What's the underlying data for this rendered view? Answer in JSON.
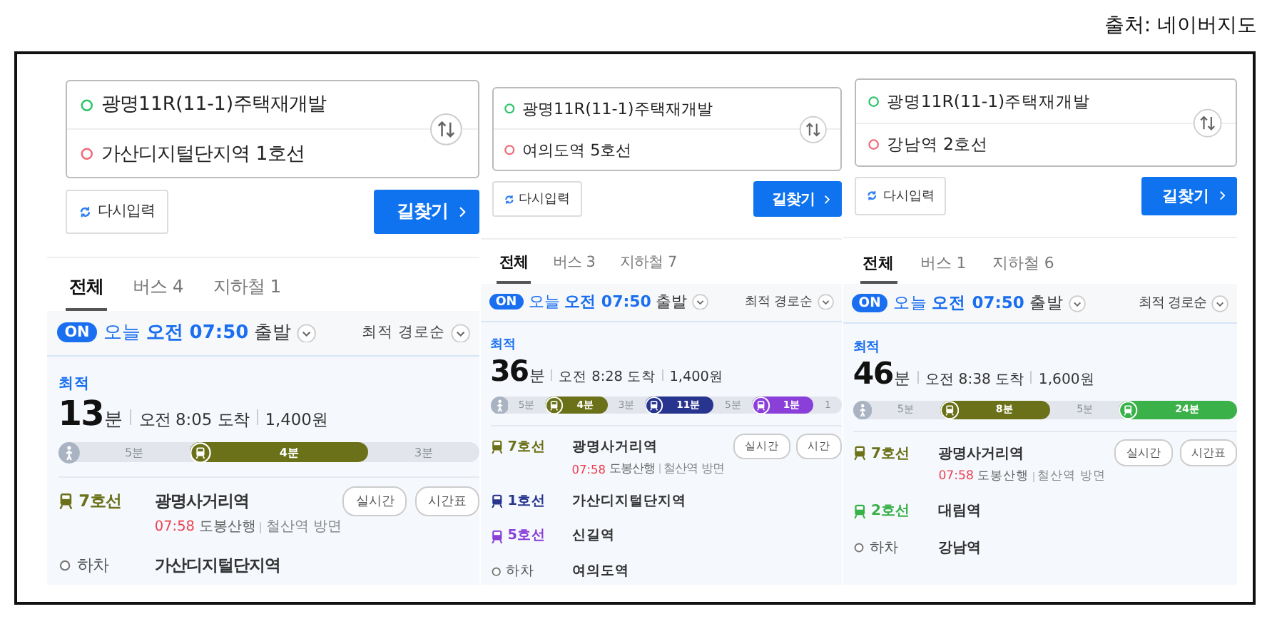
{
  "source": "출처: 네이버지도",
  "panels": [
    {
      "origin": "광명11R(11-1)주택재개발",
      "destination": "가산디지털단지역 1호선",
      "reset_label": "다시입력",
      "search_label": "길찾기",
      "tabs": [
        {
          "label": "전체",
          "selected": true
        },
        {
          "label": "버스 4",
          "selected": false
        },
        {
          "label": "지하철 1",
          "selected": false
        }
      ],
      "on_badge": "ON",
      "day": "오늘",
      "time": "오전 07:50",
      "departure": "출발",
      "sort_label": "최적 경로순",
      "route": {
        "tag": "최적",
        "duration": "13",
        "unit": "분",
        "arrival": "오전 8:05 도착",
        "fare": "1,400원",
        "segments": [
          {
            "kind": "walk",
            "label": "5분"
          },
          {
            "kind": "subway",
            "label": "4분",
            "color": "#6b7118"
          },
          {
            "kind": "walk",
            "label": "3분"
          }
        ],
        "steps": [
          {
            "kind": "board",
            "line": "7호선",
            "color": "#6b7118",
            "station": "광명사거리역",
            "time": "07:58",
            "direction": "도봉산행",
            "exit": "철산역 방면",
            "buttons": [
              "실시간",
              "시간표"
            ]
          },
          {
            "kind": "alight",
            "line": "하차",
            "station": "가산디지털단지역"
          }
        ]
      }
    },
    {
      "origin": "광명11R(11-1)주택재개발",
      "destination": "여의도역 5호선",
      "reset_label": "다시입력",
      "search_label": "길찾기",
      "tabs": [
        {
          "label": "전체",
          "selected": true
        },
        {
          "label": "버스 3",
          "selected": false
        },
        {
          "label": "지하철 7",
          "selected": false
        }
      ],
      "on_badge": "ON",
      "day": "오늘",
      "time": "오전 07:50",
      "departure": "출발",
      "sort_label": "최적 경로순",
      "route": {
        "tag": "최적",
        "duration": "36",
        "unit": "분",
        "arrival": "오전 8:28 도착",
        "fare": "1,400원",
        "segments": [
          {
            "kind": "walk",
            "label": "5분"
          },
          {
            "kind": "subway",
            "label": "4분",
            "color": "#6b7118"
          },
          {
            "kind": "walk",
            "label": "3분"
          },
          {
            "kind": "subway",
            "label": "11분",
            "color": "#27358f"
          },
          {
            "kind": "walk",
            "label": "5분"
          },
          {
            "kind": "subway",
            "label": "1분",
            "color": "#8a3fd9"
          },
          {
            "kind": "walk",
            "label": "1"
          }
        ],
        "steps": [
          {
            "kind": "board",
            "line": "7호선",
            "color": "#6b7118",
            "station": "광명사거리역",
            "time": "07:58",
            "direction": "도봉산행",
            "exit": "철산역 방면",
            "buttons": [
              "실시간",
              "시간"
            ]
          },
          {
            "kind": "ride",
            "line": "1호선",
            "color": "#27358f",
            "station": "가산디지털단지역"
          },
          {
            "kind": "ride",
            "line": "5호선",
            "color": "#8a3fd9",
            "station": "신길역"
          },
          {
            "kind": "alight",
            "line": "하차",
            "station": "여의도역"
          }
        ]
      }
    },
    {
      "origin": "광명11R(11-1)주택재개발",
      "destination": "강남역 2호선",
      "reset_label": "다시입력",
      "search_label": "길찾기",
      "tabs": [
        {
          "label": "전체",
          "selected": true
        },
        {
          "label": "버스 1",
          "selected": false
        },
        {
          "label": "지하철 6",
          "selected": false
        }
      ],
      "on_badge": "ON",
      "day": "오늘",
      "time": "오전 07:50",
      "departure": "출발",
      "sort_label": "최적 경로순",
      "route": {
        "tag": "최적",
        "duration": "46",
        "unit": "분",
        "arrival": "오전 8:38 도착",
        "fare": "1,600원",
        "segments": [
          {
            "kind": "walk",
            "label": "5분"
          },
          {
            "kind": "subway",
            "label": "8분",
            "color": "#6b7118"
          },
          {
            "kind": "walk",
            "label": "5분"
          },
          {
            "kind": "subway",
            "label": "24분",
            "color": "#3bb14a"
          }
        ],
        "steps": [
          {
            "kind": "board",
            "line": "7호선",
            "color": "#6b7118",
            "station": "광명사거리역",
            "time": "07:58",
            "direction": "도봉산행",
            "exit": "철산역 방면",
            "buttons": [
              "실시간",
              "시간표"
            ]
          },
          {
            "kind": "ride",
            "line": "2호선",
            "color": "#3bb14a",
            "station": "대림역"
          },
          {
            "kind": "alight",
            "line": "하차",
            "station": "강남역"
          }
        ]
      }
    }
  ]
}
